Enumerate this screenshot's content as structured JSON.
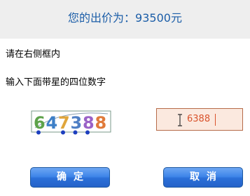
{
  "header": {
    "price_label": "您的出价为：",
    "price_value": "93500元"
  },
  "instructions": {
    "line1": "请在右侧框内",
    "line2": "输入下面带星的四位数字"
  },
  "captcha": {
    "digits": [
      {
        "char": "6",
        "color": "#5da24a",
        "starred": true
      },
      {
        "char": "4",
        "color": "#3d7fc7",
        "starred": false
      },
      {
        "char": "7",
        "color": "#e0a63c",
        "starred": true
      },
      {
        "char": "3",
        "color": "#4f7fc4",
        "starred": true
      },
      {
        "char": "8",
        "color": "#9a62c7",
        "starred": true
      },
      {
        "char": "8",
        "color": "#e07a3a",
        "starred": false
      }
    ],
    "star_color": "#1d3fbf"
  },
  "answer": {
    "value": "6388"
  },
  "buttons": {
    "confirm_label": "确定",
    "cancel_label": "取消"
  },
  "colors": {
    "header_text": "#1c5ea8",
    "button_blue": "#3f86e9",
    "input_border": "#b66b49",
    "input_text": "#d9532c"
  }
}
